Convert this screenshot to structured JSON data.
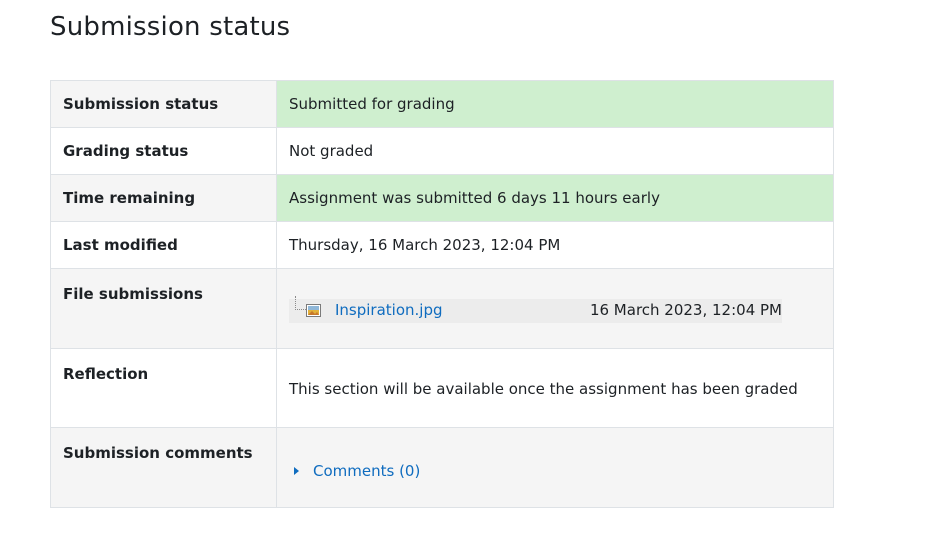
{
  "page": {
    "title": "Submission status"
  },
  "rows": {
    "submission_status": {
      "label": "Submission status",
      "value": "Submitted for grading"
    },
    "grading_status": {
      "label": "Grading status",
      "value": "Not graded"
    },
    "time_remaining": {
      "label": "Time remaining",
      "value": "Assignment was submitted 6 days 11 hours early"
    },
    "last_modified": {
      "label": "Last modified",
      "value": "Thursday, 16 March 2023, 12:04 PM"
    },
    "file_submissions": {
      "label": "File submissions",
      "file_name": "Inspiration.jpg",
      "file_date": "16 March 2023, 12:04 PM",
      "file_icon": "image-file-icon"
    },
    "reflection": {
      "label": "Reflection",
      "value": "This section will be available once the assignment has been graded"
    },
    "submission_comments": {
      "label": "Submission comments",
      "toggle_label": "Comments (0)"
    }
  },
  "colors": {
    "success_bg": "#cfefcf",
    "link": "#0f6cbf",
    "header_bg": "#f5f5f5",
    "border": "#dee2e6"
  }
}
